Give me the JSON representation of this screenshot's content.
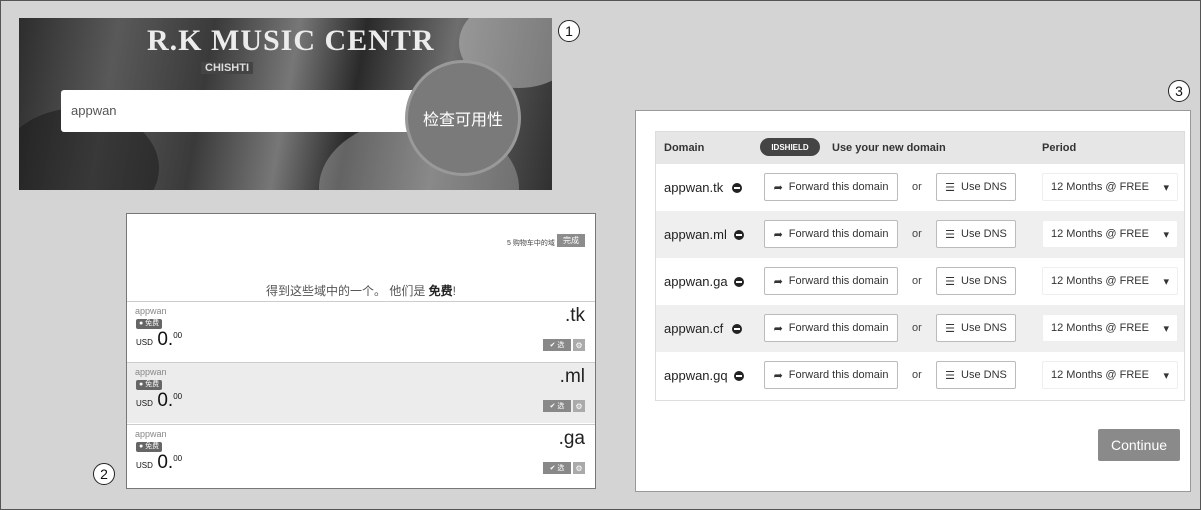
{
  "markers": [
    "1",
    "2",
    "3"
  ],
  "panel1": {
    "sign_text": "R.K MUSIC CENTR",
    "sign_sub": "CHISHTI",
    "search_value": "appwan",
    "check_button": "检查可用性"
  },
  "panel2": {
    "cart_info": "5 购物车中的域",
    "done_button": "完成",
    "headline_prefix": "得到这些域中的一个。 他们是 ",
    "headline_bold": "免费",
    "headline_suffix": "!",
    "rows": [
      {
        "name": "appwan",
        "badge": "● 免费",
        "currency": "USD",
        "price_main": "0.",
        "price_sup": "00",
        "tld": ".tk",
        "select_label": "✔ 选"
      },
      {
        "name": "appwan",
        "badge": "● 免费",
        "currency": "USD",
        "price_main": "0.",
        "price_sup": "00",
        "tld": ".ml",
        "select_label": "✔ 选"
      },
      {
        "name": "appwan",
        "badge": "● 免费",
        "currency": "USD",
        "price_main": "0.",
        "price_sup": "00",
        "tld": ".ga",
        "select_label": "✔ 选"
      }
    ]
  },
  "panel3": {
    "headers": {
      "domain": "Domain",
      "shield": "IDSHIELD",
      "use": "Use your new domain",
      "period": "Period"
    },
    "rows": [
      {
        "domain": "appwan.tk",
        "forward": "Forward this domain",
        "or": "or",
        "dns": "Use DNS",
        "period": "12 Months @ FREE"
      },
      {
        "domain": "appwan.ml",
        "forward": "Forward this domain",
        "or": "or",
        "dns": "Use DNS",
        "period": "12 Months @ FREE"
      },
      {
        "domain": "appwan.ga",
        "forward": "Forward this domain",
        "or": "or",
        "dns": "Use DNS",
        "period": "12 Months @ FREE"
      },
      {
        "domain": "appwan.cf",
        "forward": "Forward this domain",
        "or": "or",
        "dns": "Use DNS",
        "period": "12 Months @ FREE"
      },
      {
        "domain": "appwan.gq",
        "forward": "Forward this domain",
        "or": "or",
        "dns": "Use DNS",
        "period": "12 Months @ FREE"
      }
    ],
    "continue_button": "Continue"
  }
}
